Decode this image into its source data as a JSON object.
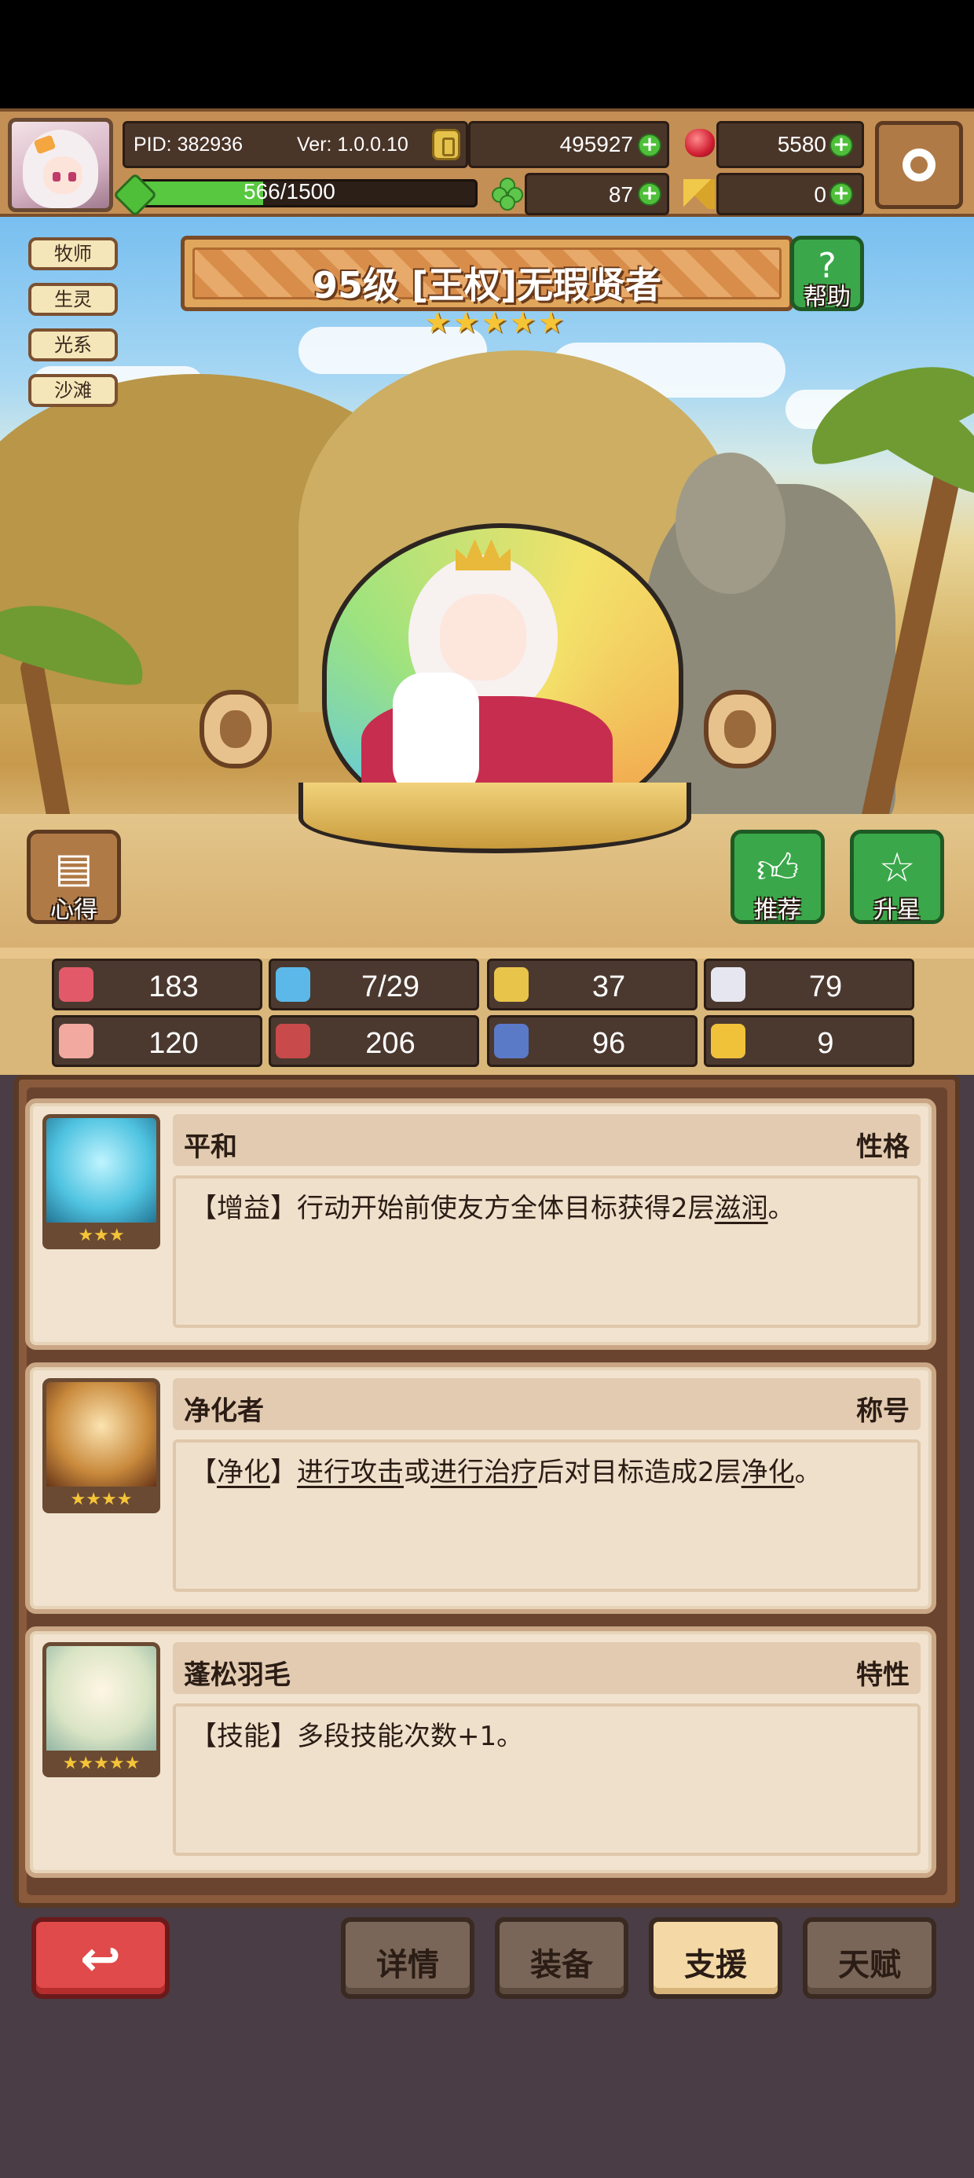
{
  "header": {
    "pid": "PID: 382936",
    "version": "Ver: 1.0.0.10",
    "gold": "495927",
    "ruby": "5580",
    "clover": "87",
    "keys": "0",
    "xp_text": "566/1500",
    "xp_progress": 0.377
  },
  "hero": {
    "name": "95级 [王权]无瑕贤者",
    "stars": 5,
    "tags": [
      "牧师",
      "生灵",
      "光系",
      "沙滩"
    ],
    "help_label": "帮助",
    "book_label": "心得",
    "recommend_label": "推荐",
    "upstar_label": "升星"
  },
  "stats": [
    {
      "icon": "heart-icon",
      "value": "183"
    },
    {
      "icon": "water-drop-icon",
      "value": "7/29"
    },
    {
      "icon": "shield-icon",
      "value": "37"
    },
    {
      "icon": "wing-icon",
      "value": "79"
    },
    {
      "icon": "fist-icon",
      "value": "120"
    },
    {
      "icon": "spellbook-icon",
      "value": "206"
    },
    {
      "icon": "scroll-icon",
      "value": "96"
    },
    {
      "icon": "horseshoe-icon",
      "value": "9"
    }
  ],
  "traits": [
    {
      "name": "平和",
      "type": "性格",
      "stars": "★★★",
      "desc_parts": [
        "【增益】行动开始前使友方全体目标获得2层",
        "滋润",
        "。"
      ]
    },
    {
      "name": "净化者",
      "type": "称号",
      "stars": "★★★★",
      "desc_parts": [
        "【",
        "净化",
        "】",
        "进行攻击",
        "或",
        "进行治疗",
        "后对目标造成2层",
        "净化",
        "。"
      ]
    },
    {
      "name": "蓬松羽毛",
      "type": "特性",
      "stars": "★★★★★",
      "desc_parts": [
        "【技能】多段技能次数+1。"
      ]
    }
  ],
  "bottom": {
    "details": "详情",
    "equip": "装备",
    "support": "支援",
    "talent": "天赋"
  },
  "colors": {
    "accent_green": "#3aa84a",
    "back_red": "#e14a4a",
    "star_gold": "#f5c437"
  }
}
